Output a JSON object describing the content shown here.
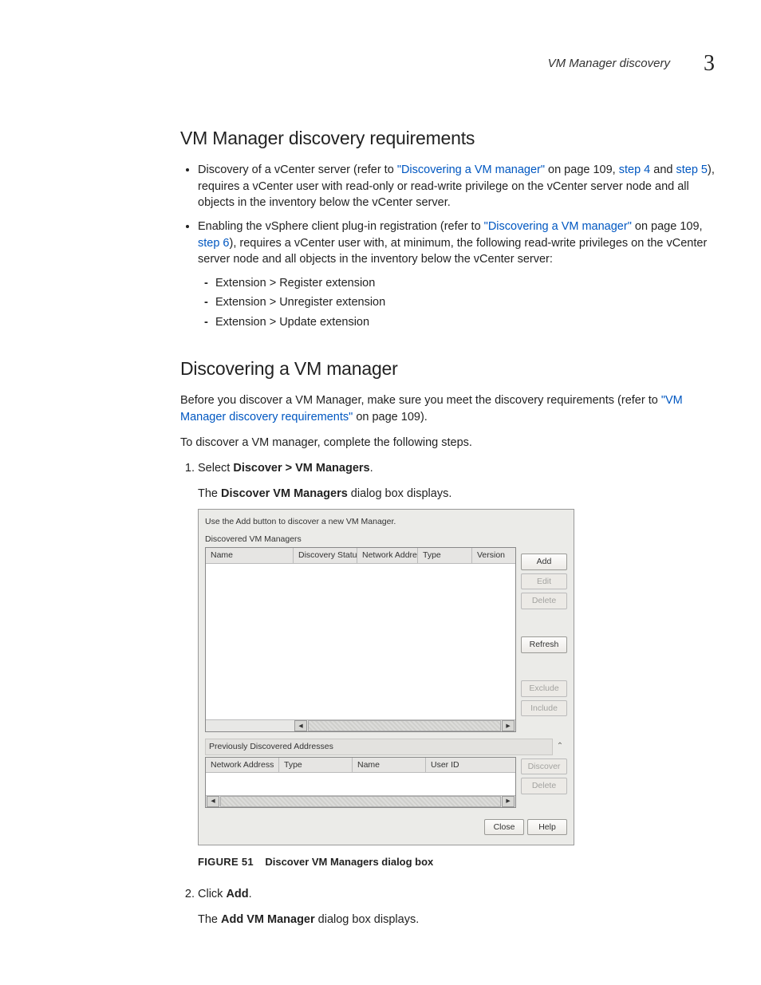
{
  "header": {
    "running_title": "VM Manager discovery",
    "chapter_number": "3"
  },
  "section1": {
    "title": "VM Manager discovery requirements",
    "bullet1": {
      "t1": "Discovery of a vCenter server (refer to ",
      "link1": "\"Discovering a VM manager\"",
      "t2": " on page 109, ",
      "link2": "step 4",
      "t3": " and ",
      "link3": "step 5",
      "t4": "), requires a vCenter user with read-only or read-write privilege on the vCenter server node and all objects in the inventory below the vCenter server."
    },
    "bullet2": {
      "t1": "Enabling the vSphere client plug-in registration (refer to ",
      "link1": "\"Discovering a VM manager\"",
      "t2": " on page 109, ",
      "link2": "step 6",
      "t3": "), requires a vCenter user with, at minimum, the following read-write privileges on the vCenter server node and all objects in the inventory below the vCenter server:",
      "d1": "Extension > Register extension",
      "d2": "Extension > Unregister extension",
      "d3": "Extension > Update extension"
    }
  },
  "section2": {
    "title": "Discovering a VM manager",
    "intro": {
      "t1": "Before you discover a VM Manager, make sure you meet the discovery requirements (refer to ",
      "link1": "\"VM Manager discovery requirements\"",
      "t2": " on page 109)."
    },
    "lead": "To discover a VM manager, complete the following steps.",
    "step1": {
      "prefix": "Select ",
      "bold": "Discover > VM Managers",
      "suffix": ".",
      "body_prefix": "The ",
      "body_bold": "Discover VM Managers",
      "body_suffix": " dialog box displays."
    },
    "step2": {
      "prefix": "Click ",
      "bold": "Add",
      "suffix": ".",
      "body_prefix": "The ",
      "body_bold": "Add VM Manager",
      "body_suffix": " dialog box displays."
    },
    "figure": {
      "num": "FIGURE 51",
      "caption": "Discover VM Managers dialog box"
    }
  },
  "dialog": {
    "instruction": "Use the Add button to discover a new VM Manager.",
    "discovered_label": "Discovered VM Managers",
    "cols1": {
      "c1": "Name",
      "c2": "Discovery Status",
      "c3": "Network Address",
      "c4": "Type",
      "c5": "Version"
    },
    "buttons1": {
      "add": "Add",
      "edit": "Edit",
      "delete": "Delete",
      "refresh": "Refresh",
      "exclude": "Exclude",
      "include": "Include"
    },
    "prev_label": "Previously Discovered Addresses",
    "cols2": {
      "c1": "Network Address",
      "c2": "Type",
      "c3": "Name",
      "c4": "User ID"
    },
    "buttons2": {
      "discover": "Discover",
      "delete": "Delete"
    },
    "footer": {
      "close": "Close",
      "help": "Help"
    },
    "scroll_left": "◂",
    "scroll_right": "▸",
    "collapse_glyph": "⌃"
  }
}
